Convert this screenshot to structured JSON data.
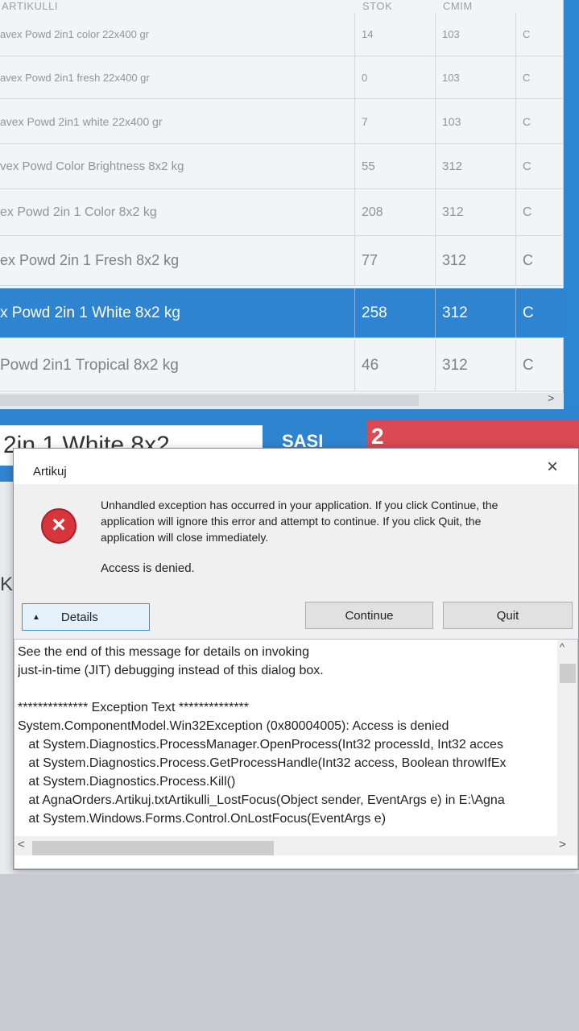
{
  "table": {
    "headers": [
      "ARTIKULLI",
      "STOK",
      "CMIM"
    ],
    "rows": [
      {
        "name": "avex Powd 2in1 color 22x400 gr",
        "stok": "14",
        "cmim": "103",
        "extra": "C"
      },
      {
        "name": "avex Powd 2in1 fresh 22x400 gr",
        "stok": "0",
        "cmim": "103",
        "extra": "C"
      },
      {
        "name": "avex Powd 2in1 white 22x400 gr",
        "stok": "7",
        "cmim": "103",
        "extra": "C"
      },
      {
        "name": "vex Powd Color Brightness 8x2 kg",
        "stok": "55",
        "cmim": "312",
        "extra": "C"
      },
      {
        "name": "ex Powd 2in 1 Color 8x2 kg",
        "stok": "208",
        "cmim": "312",
        "extra": "C"
      },
      {
        "name": "ex Powd 2in 1 Fresh 8x2 kg",
        "stok": "77",
        "cmim": "312",
        "extra": "C"
      },
      {
        "name": "x Powd 2in 1 White 8x2 kg",
        "stok": "258",
        "cmim": "312",
        "extra": "C"
      },
      {
        "name": "Powd 2in1 Tropical 8x2 kg",
        "stok": "46",
        "cmim": "312",
        "extra": "C"
      }
    ],
    "scroll_right": ">"
  },
  "form": {
    "name_value": "2in 1 White 8x2",
    "sasi_label": "SASI",
    "qty_value": "2",
    "left_fragment": "K"
  },
  "dialog": {
    "title": "Artikuj",
    "close": "×",
    "error_icon": "×",
    "message": "Unhandled exception has occurred in your application. If you click Continue, the application will ignore this error and attempt to continue. If you click Quit, the application will close immediately.",
    "short_message": "Access is denied.",
    "details_label": "Details",
    "details_arrow": "▲",
    "continue_label": "Continue",
    "quit_label": "Quit",
    "details_text": "See the end of this message for details on invoking\njust-in-time (JIT) debugging instead of this dialog box.\n\n************** Exception Text **************\nSystem.ComponentModel.Win32Exception (0x80004005): Access is denied\n   at System.Diagnostics.ProcessManager.OpenProcess(Int32 processId, Int32 acces\n   at System.Diagnostics.Process.GetProcessHandle(Int32 access, Boolean throwIfEx\n   at System.Diagnostics.Process.Kill()\n   at AgnaOrders.Artikuj.txtArtikulli_LostFocus(Object sender, EventArgs e) in E:\\Agna\n   at System.Windows.Forms.Control.OnLostFocus(EventArgs e)",
    "scroll_up": "^",
    "scroll_left": "<",
    "scroll_right": ">"
  },
  "colors": {
    "accent": "#2f84d0",
    "error": "#d8343c",
    "qty_box": "#d94a52"
  }
}
